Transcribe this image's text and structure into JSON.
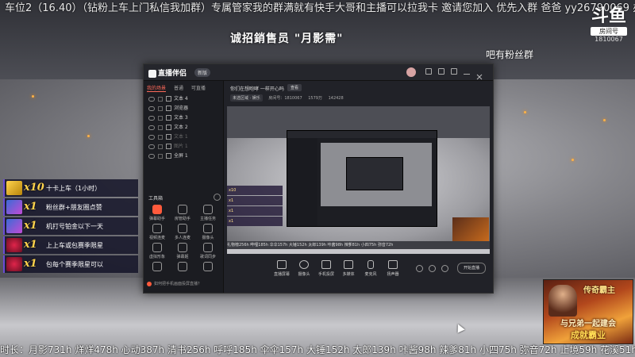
{
  "ticker_top": "车位2（16.40）（钻粉上车上门私信我加群）专属管家我的群满就有快手大哥和主播可以拉我卡 邀请您加入 优先入群 爸爸 yy26790069 办卡听我叫哥哥吗鱼吧有粉丝群",
  "center_title": "诚招銷售员 \"月影需\"",
  "logo": {
    "big": "斗鱼",
    "small": "房间号",
    "num": "1810067"
  },
  "right_ticker": "吧有粉丝群",
  "app": {
    "title": "直播伴侣",
    "version": "新版",
    "sidebar_tabs": [
      "我的场景",
      "普通",
      "可直播"
    ],
    "scenes": [
      {
        "label": "文本 4",
        "dim": false
      },
      {
        "label": "浏览器",
        "dim": false
      },
      {
        "label": "文本 3",
        "dim": false
      },
      {
        "label": "文本 2",
        "dim": false
      },
      {
        "label": "文本 1",
        "dim": true
      },
      {
        "label": "图片 1",
        "dim": true
      },
      {
        "label": "全屏 1",
        "dim": false
      }
    ],
    "tools_label": "工具箱",
    "tools": [
      "弹幕助手",
      "房管助手",
      "主播任务",
      "视频连麦",
      "多人连麦",
      "摄像头",
      "虚拟形象",
      "弹幕姬",
      "歌词同步",
      "直播截图",
      "录像",
      "动图"
    ],
    "sidebar_footer": "如何把手机画面投屏直播？",
    "room_title": "你们在想咆哮 一样开心吗",
    "room_badge": "查看",
    "room_info": {
      "category": "未选区域 · 娱乐",
      "id": "房间号：1810067",
      "viewers": "1579万",
      "followers": "142428"
    },
    "preview_strip": "礼物榜256h 哔哩185h 伞伞157h 大锤152h 太郎139h 咔酱98h 辣爹81h 小四75h 弥音72h",
    "bottom_buttons": [
      "直播屏幕",
      "摄像头",
      "手机投屏",
      "多媒体",
      "麦克风",
      "扬声器"
    ],
    "start_button": "开始直播"
  },
  "gifts": [
    {
      "qty": "x10",
      "desc": "十卡上车（1小时）",
      "icon": "card-icon"
    },
    {
      "qty": "x1",
      "desc": "粉丝群+朋友圈点赞",
      "icon": "gift-icon"
    },
    {
      "qty": "x1",
      "desc": "机打号铂金以下一天",
      "icon": "gift-icon"
    },
    {
      "qty": "x1",
      "desc": "上上车或包赛季限星",
      "icon": "rose-icon"
    },
    {
      "qty": "x1",
      "desc": "包每个赛季限星可以",
      "icon": "rose-icon"
    }
  ],
  "promo": {
    "title": "传奇霸主",
    "line1": "与兄弟一起建会",
    "line2": "成就霸业"
  },
  "ticker_bottom": "时长：月影731h 烊烊478h 心动387h 清书256h 呼呼185h 伞伞157h 大锤152h 太郎139h 咔酱98h 辣爹81h 小四75h 弥音72h 止境59h 花溪51h 彼"
}
